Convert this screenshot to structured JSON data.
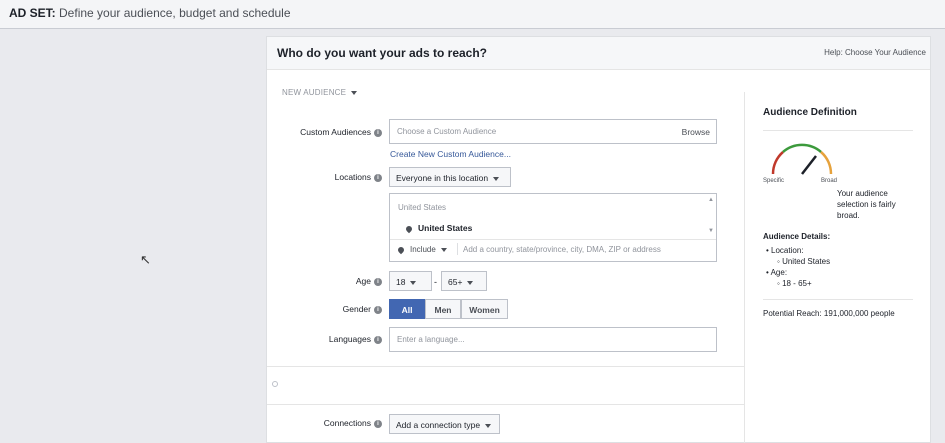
{
  "topbar": {
    "label": "AD SET:",
    "text": "Define your audience, budget and schedule"
  },
  "panel": {
    "title": "Who do you want your ads to reach?",
    "help_prefix": "Help:",
    "help_link": "Choose Your Audience"
  },
  "audience": {
    "selector": "NEW AUDIENCE"
  },
  "custom_audiences": {
    "label": "Custom Audiences",
    "placeholder": "Choose a Custom Audience",
    "browse": "Browse",
    "create_link": "Create New Custom Audience..."
  },
  "locations": {
    "label": "Locations",
    "dropdown": "Everyone in this location",
    "country_header": "United States",
    "selected": "United States",
    "include": "Include",
    "placeholder": "Add a country, state/province, city, DMA, ZIP or address"
  },
  "age": {
    "label": "Age",
    "min": "18",
    "dash": "-",
    "max": "65+"
  },
  "gender": {
    "label": "Gender",
    "options": [
      "All",
      "Men",
      "Women"
    ],
    "selected": "All"
  },
  "languages": {
    "label": "Languages",
    "placeholder": "Enter a language..."
  },
  "connections": {
    "label": "Connections",
    "dropdown": "Add a connection type"
  },
  "sidebar": {
    "title": "Audience Definition",
    "gauge_specific": "Specific",
    "gauge_broad": "Broad",
    "description": "Your audience selection is fairly broad.",
    "details_title": "Audience Details:",
    "location_label": "Location:",
    "location_value": "United States",
    "age_label": "Age:",
    "age_value": "18 - 65+",
    "potential_reach": "Potential Reach: 191,000,000 people"
  },
  "colors": {
    "accent": "#4267b2",
    "link": "#365899",
    "gauge_red": "#c0392b",
    "gauge_green": "#3c9a3c",
    "gauge_orange": "#e6a23c"
  }
}
